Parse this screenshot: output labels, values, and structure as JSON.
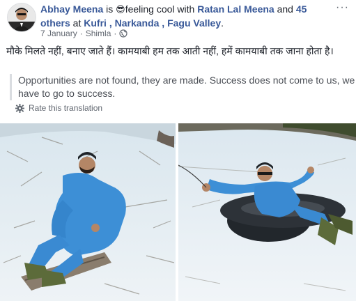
{
  "post": {
    "author": "Abhay Meena",
    "is_text": " is ",
    "emoji": "😎",
    "feeling_text": "feeling cool with ",
    "tagged_user": "Ratan Lal Meena",
    "and_text": " and ",
    "others_text": "45 others",
    "at_text": " at ",
    "location": "Kufri , Narkanda , Fagu Valley",
    "period": ".",
    "date": "7 January",
    "separator": "·",
    "place": "Shimla",
    "separator2": "·",
    "more_icon": "···",
    "hindi_text": "मौके मिलते नहीं, बनाए जाते हैं। कामयाबी हम तक आती नहीं, हमें कामयाबी तक जाना होता है।",
    "translation_text": "Opportunities are not found, they are made. Success does not come to us, we have to go to success.",
    "rate_translation": "Rate this translation"
  },
  "colors": {
    "link": "#385898",
    "text": "#1d2129",
    "meta": "#616770",
    "quote_border": "#dadde1"
  },
  "icons": {
    "avatar": "profile-photo",
    "privacy": "globe-icon",
    "options": "more-options-icon",
    "settings": "gear-icon"
  }
}
